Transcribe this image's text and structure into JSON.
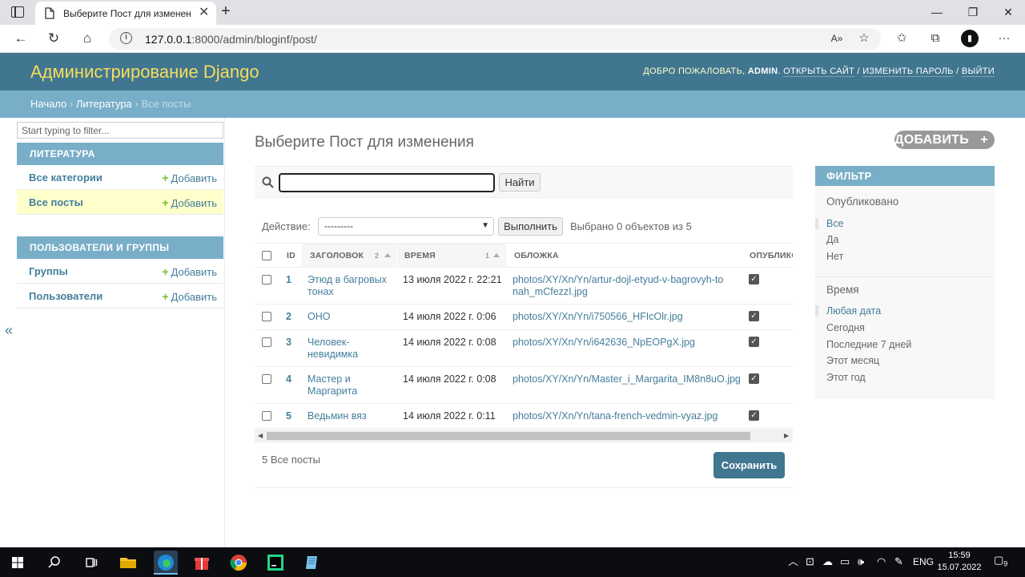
{
  "browser": {
    "tab_title": "Выберите Пост для изменения",
    "address_host": "127.0.0.1",
    "address_path": ":8000/admin/bloginf/post/"
  },
  "header": {
    "branding": "Администрирование Django",
    "welcome": "Добро пожаловать,",
    "username": "admin",
    "view_site": "Открыть сайт",
    "change_password": "Изменить пароль",
    "logout": "Выйти"
  },
  "breadcrumbs": {
    "home": "Начало",
    "app": "Литература",
    "current": "Все посты"
  },
  "sidebar": {
    "filter_placeholder": "Start typing to filter...",
    "modules": [
      {
        "caption": "Литература",
        "rows": [
          {
            "label": "Все категории",
            "add": "Добавить"
          },
          {
            "label": "Все посты",
            "add": "Добавить"
          }
        ]
      },
      {
        "caption": "Пользователи и группы",
        "rows": [
          {
            "label": "Группы",
            "add": "Добавить"
          },
          {
            "label": "Пользователи",
            "add": "Добавить"
          }
        ]
      }
    ],
    "collapse_glyph": "«"
  },
  "content": {
    "title": "Выберите Пост для изменения",
    "add_button": "Добавить пост",
    "search_button": "Найти",
    "action_label": "Действие:",
    "action_selected": "---------",
    "run_button": "Выполнить",
    "selected_count": "Выбрано 0 объектов из 5",
    "columns": {
      "id": "ID",
      "title": "Заголовок",
      "title_sort": "2",
      "time": "Время",
      "time_sort": "1",
      "cover": "Обложка",
      "published": "Опублико"
    },
    "rows": [
      {
        "id": "1",
        "title": "Этюд в багровых тонах",
        "time": "13 июля 2022 г. 22:21",
        "cover": "photos/XY/Xn/Yn/artur-dojl-etyud-v-bagrovyh-tonah_mCfezzI.jpg",
        "published": true
      },
      {
        "id": "2",
        "title": "ОНО",
        "time": "14 июля 2022 г. 0:06",
        "cover": "photos/XY/Xn/Yn/i750566_HFIcOlr.jpg",
        "published": true
      },
      {
        "id": "3",
        "title": "Человек-невидимка",
        "time": "14 июля 2022 г. 0:08",
        "cover": "photos/XY/Xn/Yn/i642636_NpEOPgX.jpg",
        "published": true
      },
      {
        "id": "4",
        "title": "Мастер и Маргарита",
        "time": "14 июля 2022 г. 0:08",
        "cover": "photos/XY/Xn/Yn/Master_i_Margarita_IM8n8uO.jpg",
        "published": true
      },
      {
        "id": "5",
        "title": "Ведьмин вяз",
        "time": "14 июля 2022 г. 0:11",
        "cover": "photos/XY/Xn/Yn/tana-french-vedmin-vyaz.jpg",
        "published": true
      }
    ],
    "paginator": "5 Все посты",
    "save_button": "Сохранить"
  },
  "filter": {
    "caption": "Фильтр",
    "groups": [
      {
        "title": "Опубликовано",
        "items": [
          "Все",
          "Да",
          "Нет"
        ],
        "selected": 0
      },
      {
        "title": "Время",
        "items": [
          "Любая дата",
          "Сегодня",
          "Последние 7 дней",
          "Этот месяц",
          "Этот год"
        ],
        "selected": 0
      }
    ]
  },
  "taskbar": {
    "language": "ENG",
    "time": "15:59",
    "date": "15.07.2022",
    "notifications": "9"
  },
  "colors": {
    "header": "#417690",
    "breadcrumbs": "#79aec8",
    "branding": "#f5dd5d",
    "link": "#447e9b",
    "current_row": "#ffffcc",
    "add_icon": "#70bf2b"
  }
}
